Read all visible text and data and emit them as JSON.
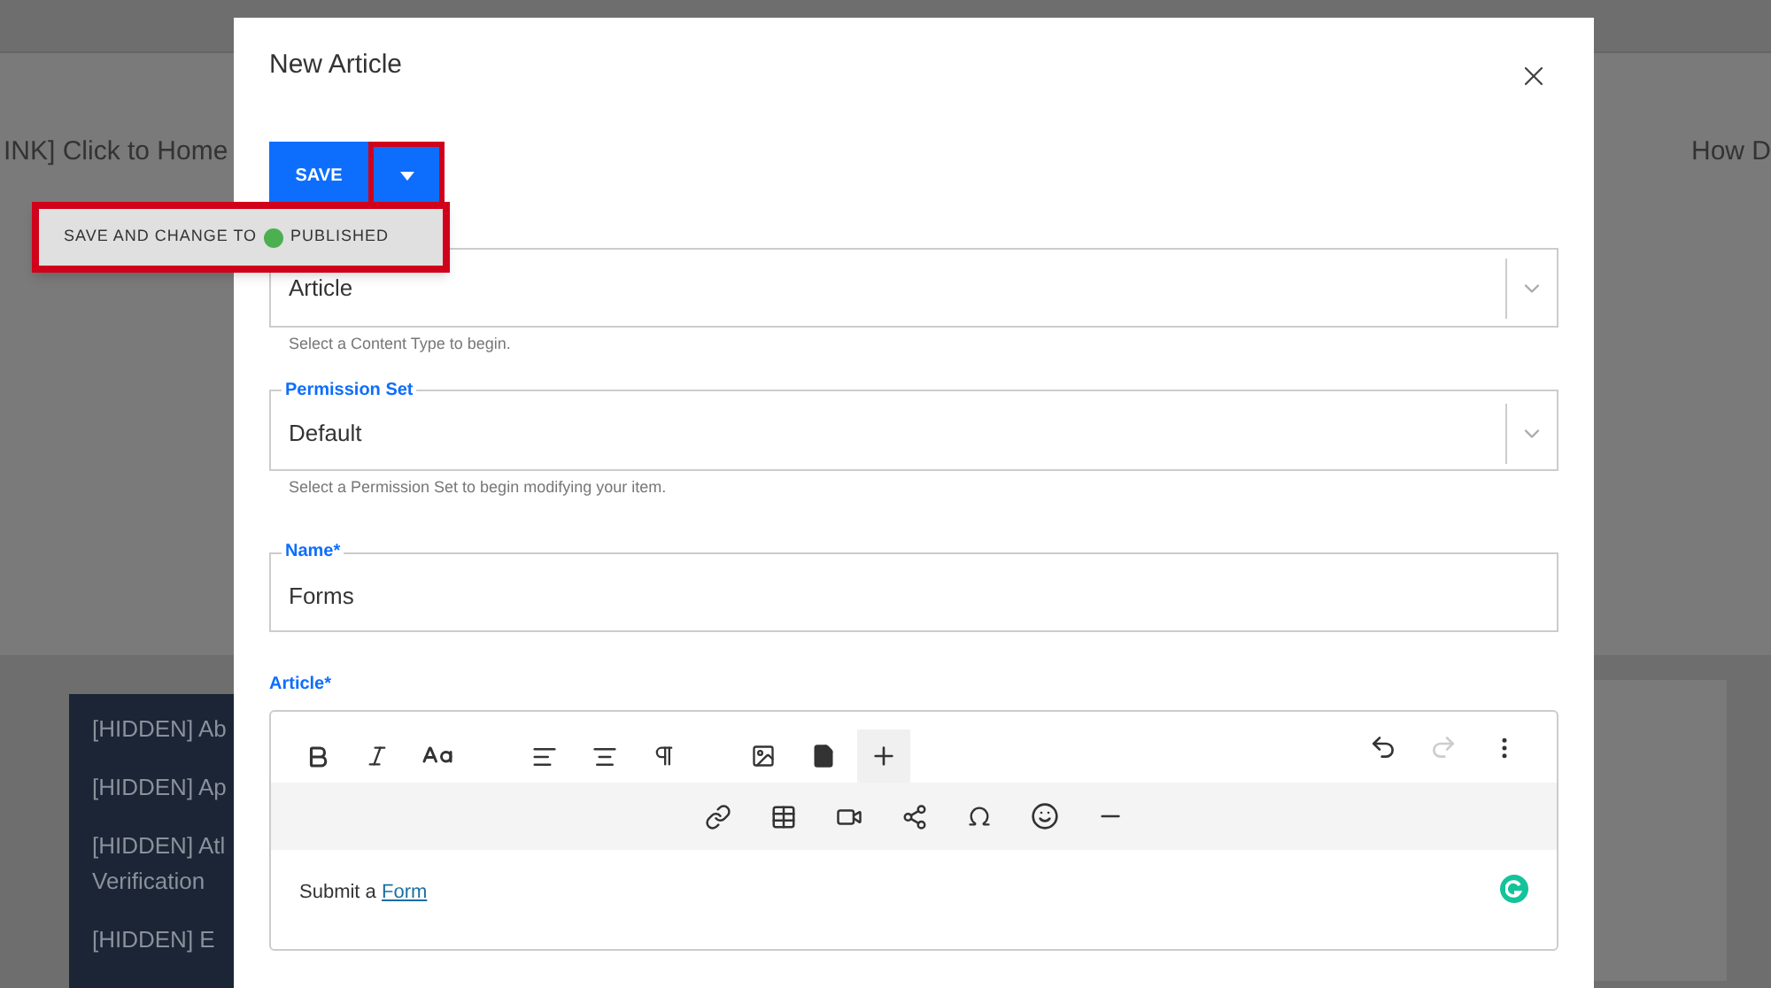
{
  "background": {
    "top_link": "INK] Click to Home",
    "right_link": "How D",
    "sidebar_items": [
      [
        "[HIDDEN] Ab"
      ],
      [
        "[HIDDEN] Ap"
      ],
      [
        "[HIDDEN] Atl",
        "Verification"
      ],
      [
        "[HIDDEN] E"
      ]
    ]
  },
  "dialog": {
    "title": "New Article",
    "save_button": "SAVE",
    "dropdown_open": true,
    "menu": {
      "label": "SAVE AND CHANGE TO",
      "status": "PUBLISHED",
      "color": "#4caf50"
    },
    "fields": [
      {
        "kind": "select",
        "value": "Article",
        "help": "Select a Content Type to begin."
      },
      {
        "kind": "select",
        "label": "Permission Set",
        "value": "Default",
        "help": "Select a Permission Set to begin modifying your item."
      },
      {
        "kind": "text",
        "label": "Name*",
        "value": "Forms"
      }
    ],
    "editor": {
      "label": "Article*",
      "insert_more_expanded": true,
      "redo_disabled": true,
      "text": "Submit a",
      "link": "Form"
    }
  }
}
